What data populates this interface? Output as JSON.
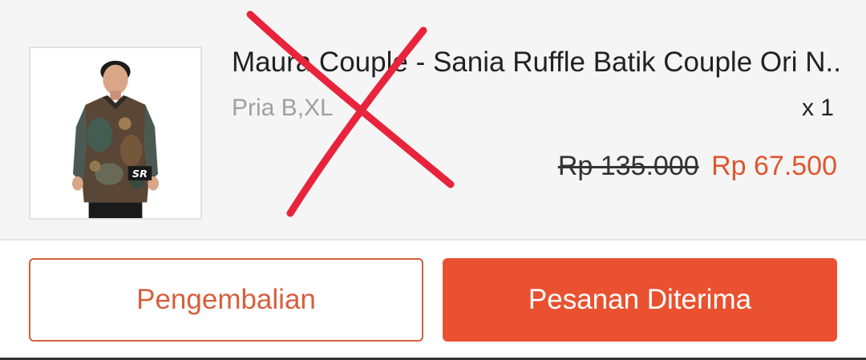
{
  "product": {
    "title": "Maura Couple - Sania Ruffle Batik Couple Ori N...",
    "variant": "Pria B,XL",
    "quantity": "x 1",
    "original_price": "Rp 135.000",
    "sale_price": "Rp 67.500",
    "image_icon": "batik-shirt-model-photo",
    "image_watermark": "SR"
  },
  "annotation": {
    "icon": "red-cross-mark",
    "color": "#e8243c"
  },
  "actions": {
    "return_label": "Pengembalian",
    "received_label": "Pesanan Diterima"
  },
  "colors": {
    "accent": "#ea5130",
    "outline": "#d5603f",
    "price": "#e0552e"
  }
}
